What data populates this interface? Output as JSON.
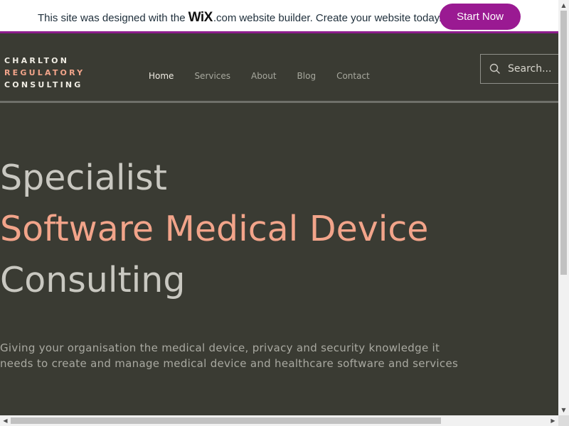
{
  "wix_banner": {
    "text_before": "This site was designed with the",
    "logo_wix": "WiX",
    "logo_com": ".com",
    "text_after": "website builder. Create your website today.",
    "button_label": "Start Now",
    "accent_color": "#9a1a92"
  },
  "header": {
    "logo": {
      "line1": "CHARLTON",
      "line2": "REGULATORY",
      "line3": "CONSULTING"
    },
    "nav": [
      "Home",
      "Services",
      "About",
      "Blog",
      "Contact"
    ],
    "active_nav": "Home",
    "search": {
      "placeholder": "Search...",
      "icon": "search-icon"
    }
  },
  "hero": {
    "line1": "Specialist",
    "line2": "Software Medical Device",
    "line3": "Consulting",
    "tagline_line1": "Giving your organisation the medical device, privacy and security knowledge it",
    "tagline_line2": "needs to create and manage medical device and healthcare software and services"
  },
  "colors": {
    "background": "#3a3b33",
    "accent_peach": "#f2a48a",
    "text_light": "#c9c8c1",
    "banner_border": "#8e1d8e"
  }
}
